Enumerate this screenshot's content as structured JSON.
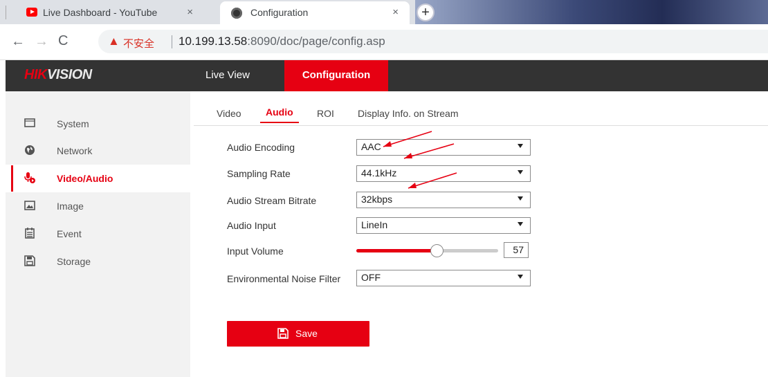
{
  "browser": {
    "tabs": [
      {
        "title": "Live Dashboard - YouTube",
        "close": "×"
      },
      {
        "title": "Configuration",
        "close": "×"
      }
    ],
    "new_tab": "+",
    "nav": {
      "back": "←",
      "forward": "→",
      "reload": "C"
    },
    "address": {
      "warning_icon": "▲",
      "security_text": "不安全",
      "host": "10.199.13.58",
      "rest": ":8090/doc/page/config.asp"
    }
  },
  "header": {
    "logo_red": "HIK",
    "logo_white": "VISION",
    "nav": [
      "Live View",
      "Configuration"
    ]
  },
  "sidebar": {
    "items": [
      {
        "label": "System",
        "icon": "monitor-icon"
      },
      {
        "label": "Network",
        "icon": "globe-icon"
      },
      {
        "label": "Video/Audio",
        "icon": "microphone-icon",
        "active": true
      },
      {
        "label": "Image",
        "icon": "image-icon"
      },
      {
        "label": "Event",
        "icon": "calendar-icon"
      },
      {
        "label": "Storage",
        "icon": "floppy-disk-icon"
      }
    ]
  },
  "subtabs": [
    "Video",
    "Audio",
    "ROI",
    "Display Info. on Stream"
  ],
  "form": {
    "audio_encoding": {
      "label": "Audio Encoding",
      "value": "AAC"
    },
    "sampling_rate": {
      "label": "Sampling Rate",
      "value": "44.1kHz"
    },
    "audio_stream_bitrate": {
      "label": "Audio Stream Bitrate",
      "value": "32kbps"
    },
    "audio_input": {
      "label": "Audio Input",
      "value": "LineIn"
    },
    "input_volume": {
      "label": "Input Volume",
      "value": "57",
      "level": 0.57
    },
    "noise_filter": {
      "label": "Environmental Noise Filter",
      "value": "OFF"
    }
  },
  "save": {
    "label": "Save"
  },
  "colors": {
    "accent": "#e60012",
    "header_bg": "#333333",
    "sidebar_bg": "#f2f2f2"
  }
}
